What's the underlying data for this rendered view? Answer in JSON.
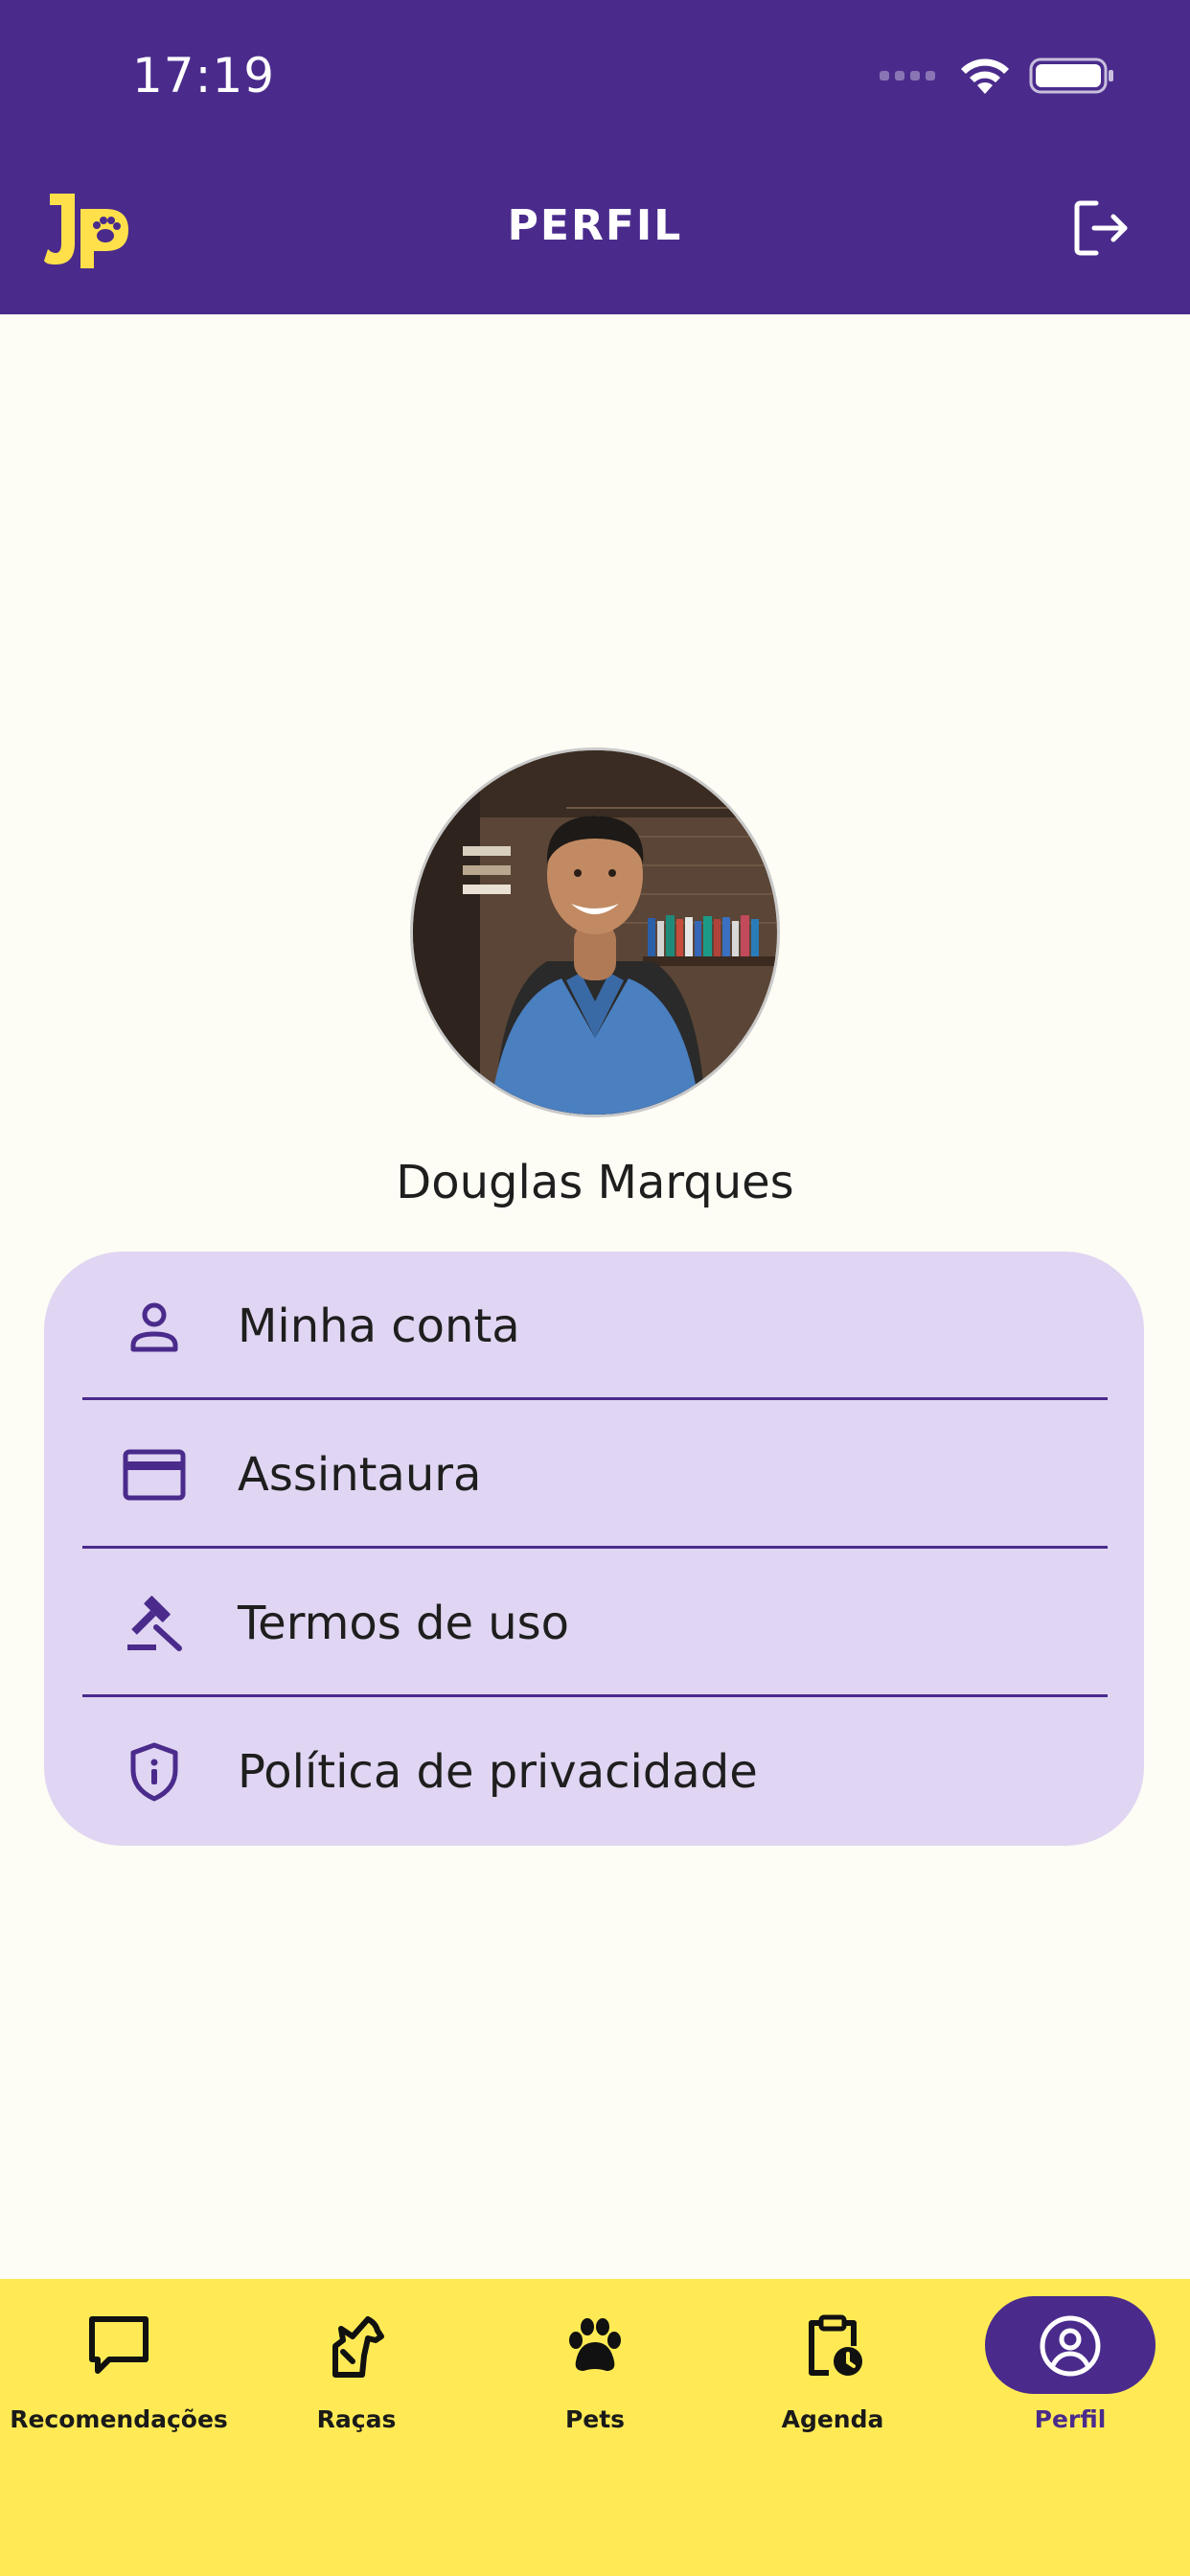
{
  "status_bar": {
    "time": "17:19"
  },
  "header": {
    "title": "PERFIL",
    "logo_text": "Jp",
    "background_color": "#4A2B8C",
    "logo_color": "#FFE04A"
  },
  "profile": {
    "name": "Douglas Marques"
  },
  "menu": {
    "items": [
      {
        "label": "Minha conta",
        "icon": "person-icon"
      },
      {
        "label": "Assintaura",
        "icon": "credit-card-icon"
      },
      {
        "label": "Termos de uso",
        "icon": "gavel-icon"
      },
      {
        "label": "Política de privacidade",
        "icon": "shield-info-icon"
      }
    ],
    "card_color": "#E0D5F2"
  },
  "bottom_nav": {
    "background_color": "#FFEA55",
    "active": "Perfil",
    "items": [
      {
        "label": "Recomendações",
        "icon": "chat-bubble-icon"
      },
      {
        "label": "Raças",
        "icon": "dog-breed-icon"
      },
      {
        "label": "Pets",
        "icon": "paw-icon"
      },
      {
        "label": "Agenda",
        "icon": "clipboard-clock-icon"
      },
      {
        "label": "Perfil",
        "icon": "account-circle-icon"
      }
    ]
  }
}
